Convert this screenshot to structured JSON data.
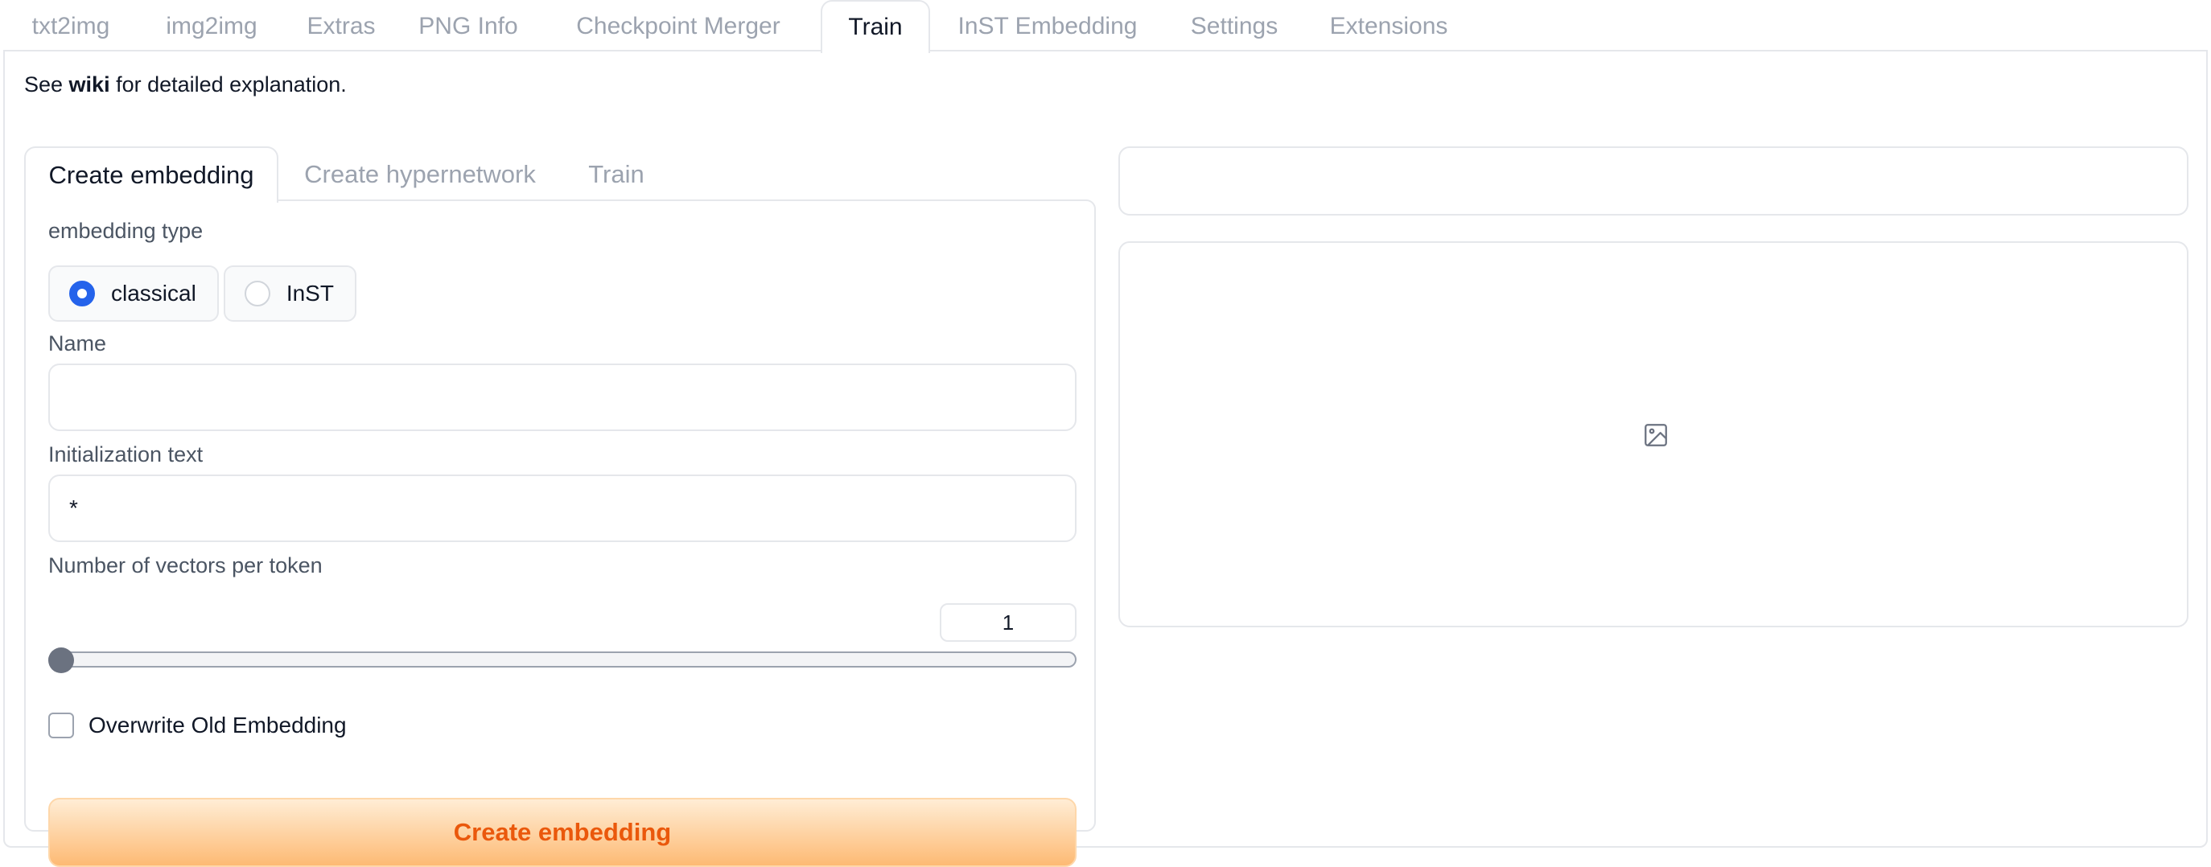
{
  "top_tabs": [
    {
      "label": "txt2img"
    },
    {
      "label": "img2img"
    },
    {
      "label": "Extras"
    },
    {
      "label": "PNG Info"
    },
    {
      "label": "Checkpoint Merger"
    },
    {
      "label": "Train",
      "active": true
    },
    {
      "label": "InST Embedding"
    },
    {
      "label": "Settings"
    },
    {
      "label": "Extensions"
    }
  ],
  "intro": {
    "prefix": "See ",
    "link": "wiki",
    "suffix": " for detailed explanation."
  },
  "sub_tabs": [
    {
      "label": "Create embedding",
      "active": true
    },
    {
      "label": "Create hypernetwork"
    },
    {
      "label": "Train"
    }
  ],
  "form": {
    "embedding_type_label": "embedding type",
    "embedding_types": [
      {
        "label": "classical",
        "checked": true
      },
      {
        "label": "InST",
        "checked": false
      }
    ],
    "name_label": "Name",
    "name_value": "",
    "init_text_label": "Initialization text",
    "init_text_value": "*",
    "vectors_label": "Number of vectors per token",
    "vectors_value": "1",
    "overwrite_label": "Overwrite Old Embedding",
    "overwrite_checked": false,
    "create_button": "Create embedding"
  },
  "right_panel": {
    "output_text": "",
    "image_placeholder_icon": "image-icon"
  },
  "colors": {
    "accent_radio": "#2563eb",
    "button_text": "#ea580c",
    "button_gradient_top": "#ffedd5",
    "button_gradient_bottom": "#fdba74"
  }
}
